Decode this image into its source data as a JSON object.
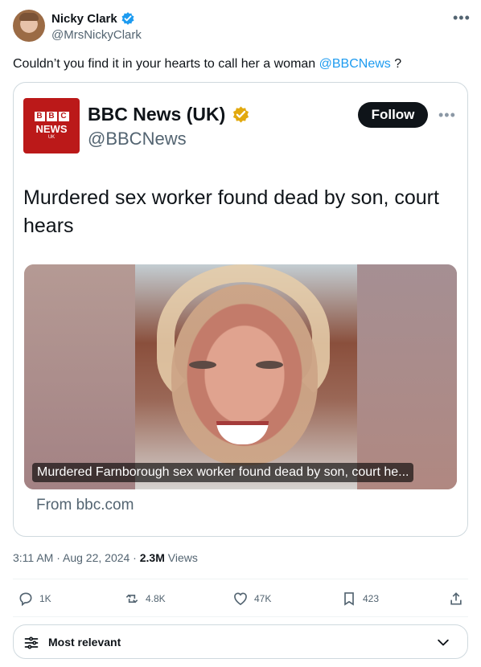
{
  "post": {
    "author": {
      "name": "Nicky Clark",
      "handle": "@MrsNickyClark",
      "verified_icon": "verified-badge-icon"
    },
    "more_icon": "more-icon",
    "text_before_mention": "Couldn’t you find it in your hearts to call her a woman ",
    "mention": "@BBCNews",
    "text_after_mention": " ?",
    "quoted_card": {
      "brand": {
        "blocks": [
          "B",
          "B",
          "C"
        ],
        "name": "NEWS",
        "region": "UK"
      },
      "name": "BBC News (UK)",
      "handle": "@BBCNews",
      "follow_label": "Follow",
      "headline": "Murdered sex worker found dead by son, court hears",
      "photo_caption": "Murdered Farnborough sex worker found dead by son, court he...",
      "source": "From bbc.com"
    },
    "meta": {
      "time": "3:11 AM",
      "separator": " · ",
      "date": "Aug 22, 2024",
      "views_count": "2.3M",
      "views_label": "Views"
    },
    "actions": {
      "replies": "1K",
      "reposts": "4.8K",
      "likes": "47K",
      "bookmarks": "423"
    }
  },
  "sort": {
    "label": "Most relevant",
    "icon": "filter-icon",
    "chevron": "chevron-down-icon"
  },
  "colors": {
    "accent": "#1d9bf0",
    "bbc_red": "#bb1919",
    "secondary_text": "#536471",
    "gold_badge": "#e2a90f"
  }
}
